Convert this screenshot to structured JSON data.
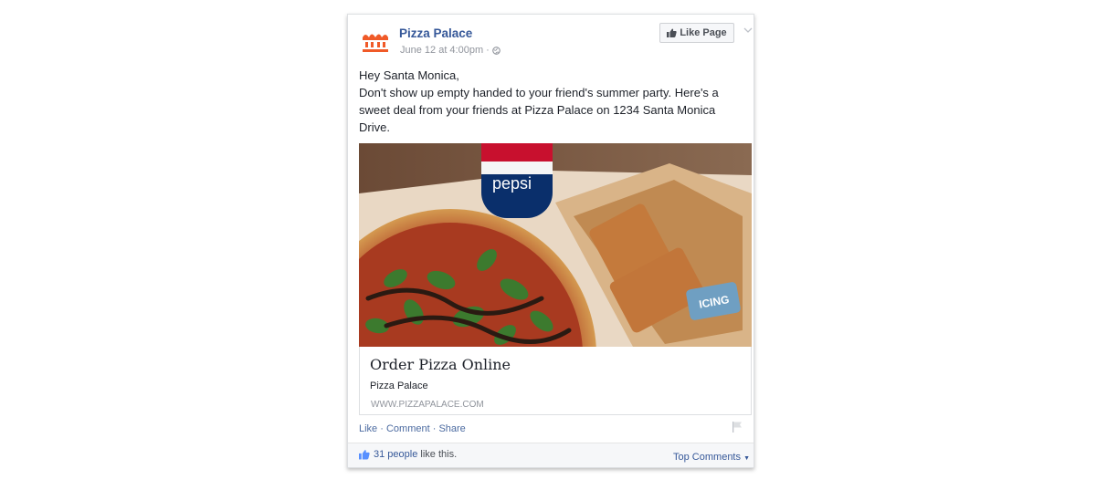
{
  "post": {
    "page_name": "Pizza Palace",
    "timestamp": "June 12 at 4:00pm",
    "meta_separator": "·",
    "like_page_label": "Like Page",
    "text_lines": [
      "Hey Santa Monica,",
      "Don't show up empty handed to your friend's summer party. Here's a",
      "sweet deal from your friends at Pizza Palace on 1234 Santa Monica",
      "Drive."
    ]
  },
  "image_labels": {
    "bottle": "pepsi",
    "icing": "ICING"
  },
  "link": {
    "title": "Order Pizza Online",
    "description": "Pizza Palace",
    "url": "WWW.PIZZAPALACE.COM"
  },
  "actions": {
    "like": "Like",
    "comment": "Comment",
    "share": "Share",
    "separator": " · "
  },
  "footer": {
    "likes_count": "31 people",
    "likes_suffix": " like this.",
    "top_comments": "Top Comments"
  },
  "colors": {
    "brand_orange": "#f05a28",
    "link_blue": "#365899"
  },
  "icons": [
    "page-logo-icon",
    "globe-icon",
    "thumbs-up-icon",
    "chevron-down-icon",
    "flag-icon"
  ]
}
